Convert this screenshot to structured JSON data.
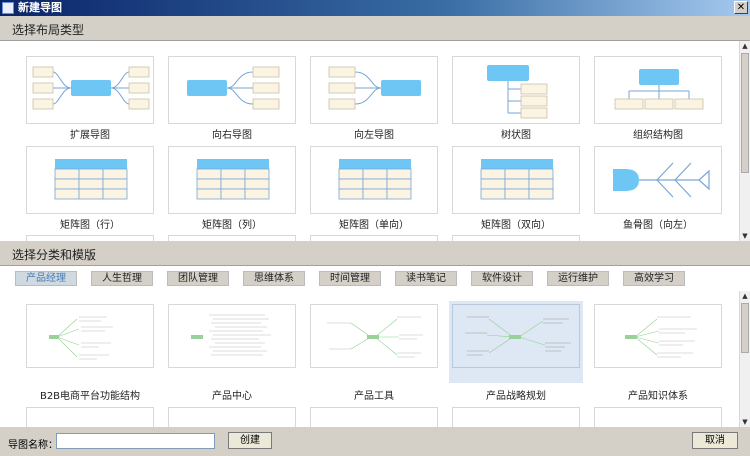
{
  "window": {
    "title": "新建导图",
    "close_glyph": "✕"
  },
  "layout_section": {
    "title": "选择布局类型",
    "items": [
      {
        "label": "扩展导图",
        "icon": "mindmap-expand-icon"
      },
      {
        "label": "向右导图",
        "icon": "mindmap-right-icon"
      },
      {
        "label": "向左导图",
        "icon": "mindmap-left-icon"
      },
      {
        "label": "树状图",
        "icon": "tree-chart-icon"
      },
      {
        "label": "组织结构图",
        "icon": "org-chart-icon"
      },
      {
        "label": "矩阵图（行）",
        "icon": "matrix-row-icon"
      },
      {
        "label": "矩阵图（列）",
        "icon": "matrix-col-icon"
      },
      {
        "label": "矩阵图（单向）",
        "icon": "matrix-oneway-icon"
      },
      {
        "label": "矩阵图（双向）",
        "icon": "matrix-twoway-icon"
      },
      {
        "label": "鱼骨图（向左）",
        "icon": "fishbone-left-icon"
      }
    ]
  },
  "template_section": {
    "title": "选择分类和模版",
    "categories": [
      "产品经理",
      "人生哲理",
      "团队管理",
      "思维体系",
      "时间管理",
      "读书笔记",
      "软件设计",
      "运行维护",
      "高效学习"
    ],
    "active_category": "产品经理",
    "templates": [
      {
        "label": "B2B电商平台功能结构"
      },
      {
        "label": "产品中心"
      },
      {
        "label": "产品工具"
      },
      {
        "label": "产品战略规划"
      },
      {
        "label": "产品知识体系"
      }
    ],
    "selected_template": "产品战略规划"
  },
  "footer": {
    "name_label": "导图名称：",
    "name_value": "",
    "create_label": "创建",
    "cancel_label": "取消"
  },
  "colors": {
    "accent_blue": "#6ec6f5",
    "node_beige": "#fbf4e3",
    "line_blue": "#7aa6d6",
    "active_tab_text": "#4a7fb8"
  }
}
